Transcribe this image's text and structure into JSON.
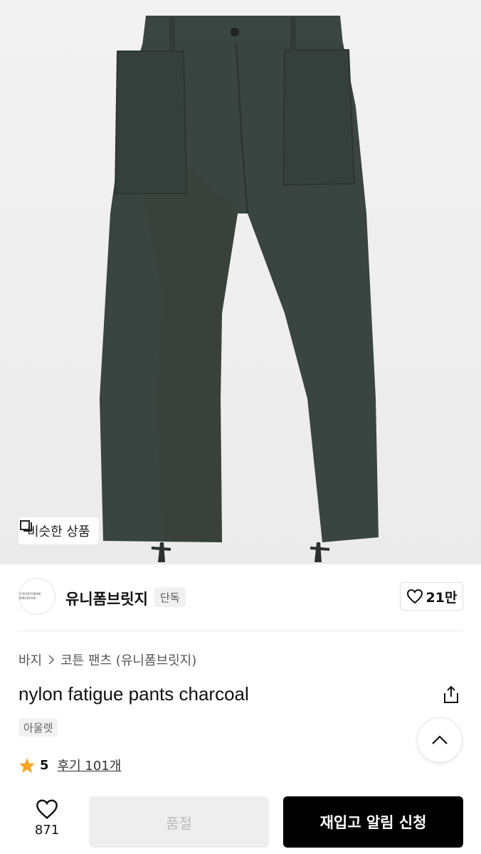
{
  "product_image": {
    "description_icon": "pants-illustration",
    "similar_button_label": "비슷한 상품",
    "similar_icon": "similar-items-icon"
  },
  "brand": {
    "logo_text": "UNIFORM BRIDGE",
    "name": "유니폼브릿지",
    "tag": "단독",
    "like_count": "21만",
    "like_icon": "heart-outline-icon"
  },
  "breadcrumb": {
    "items": [
      "바지",
      "코튼 팬츠 (유니폼브릿지)"
    ],
    "separator_icon": "chevron-right-icon"
  },
  "product": {
    "title": "nylon fatigue pants charcoal",
    "badge": "아울렛",
    "share_icon": "share-icon"
  },
  "rating": {
    "star_icon": "star-icon",
    "score": "5",
    "reviews_label": "후기 101개"
  },
  "scroll_top": {
    "icon": "chevron-up-icon"
  },
  "bottom_bar": {
    "wish_icon": "heart-outline-icon",
    "wish_count": "871",
    "soldout_label": "품절",
    "restock_label": "재입고 알림 신청"
  },
  "colors": {
    "pants": "#3a4440",
    "accent_star": "#f5a623",
    "primary_button": "#000000",
    "disabled_button": "#eeeeee"
  }
}
